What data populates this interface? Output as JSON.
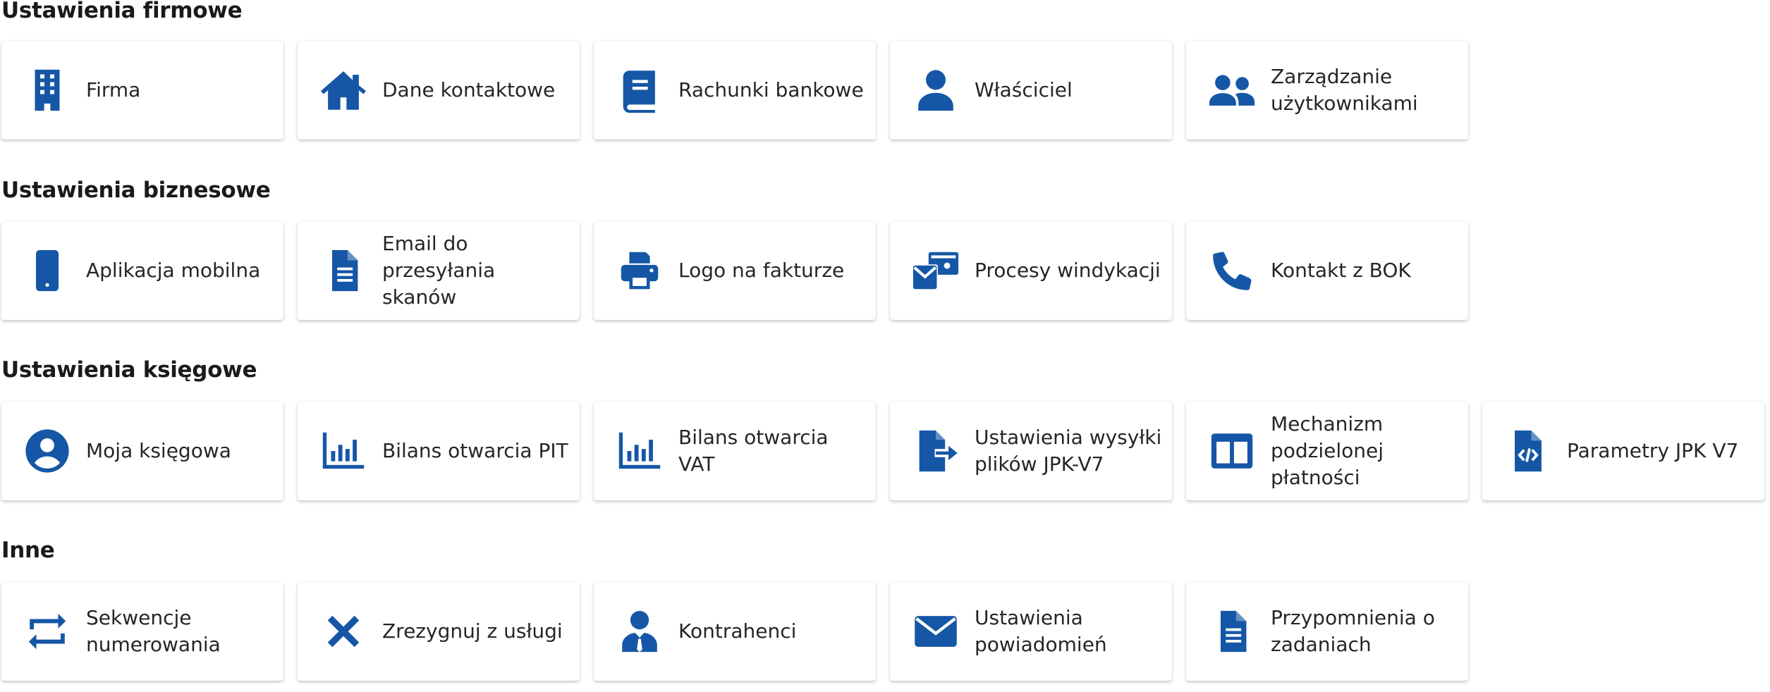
{
  "accent_color": "#1557a6",
  "sections": [
    {
      "title": "Ustawienia firmowe",
      "cards": [
        {
          "label": "Firma",
          "icon": "building-icon"
        },
        {
          "label": "Dane kontaktowe",
          "icon": "home-icon"
        },
        {
          "label": "Rachunki bankowe",
          "icon": "book-icon"
        },
        {
          "label": "Właściciel",
          "icon": "person-icon"
        },
        {
          "label": "Zarządzanie użytkownikami",
          "icon": "people-icon"
        }
      ]
    },
    {
      "title": "Ustawienia biznesowe",
      "cards": [
        {
          "label": "Aplikacja mobilna",
          "icon": "smartphone-icon"
        },
        {
          "label": "Email do przesyłania skanów",
          "icon": "document-icon"
        },
        {
          "label": "Logo na fakturze",
          "icon": "printer-icon"
        },
        {
          "label": "Procesy windykacji",
          "icon": "mail-money-icon"
        },
        {
          "label": "Kontakt z BOK",
          "icon": "phone-icon"
        }
      ]
    },
    {
      "title": "Ustawienia księgowe",
      "cards": [
        {
          "label": "Moja księgowa",
          "icon": "account-circle-icon"
        },
        {
          "label": "Bilans otwarcia PIT",
          "icon": "bar-chart-icon"
        },
        {
          "label": "Bilans otwarcia VAT",
          "icon": "bar-chart-icon"
        },
        {
          "label": "Ustawienia wysyłki plików JPK-V7",
          "icon": "file-export-icon"
        },
        {
          "label": "Mechanizm podzielonej płatności",
          "icon": "split-columns-icon"
        },
        {
          "label": "Parametry JPK V7",
          "icon": "file-code-icon"
        }
      ]
    },
    {
      "title": "Inne",
      "cards": [
        {
          "label": "Sekwencje numerowania",
          "icon": "repeat-icon"
        },
        {
          "label": "Zrezygnuj z usługi",
          "icon": "close-icon"
        },
        {
          "label": "Kontrahenci",
          "icon": "contractor-icon"
        },
        {
          "label": "Ustawienia powiadomień",
          "icon": "envelope-icon"
        },
        {
          "label": "Przypomnienia o zadaniach",
          "icon": "document-icon"
        }
      ]
    }
  ]
}
